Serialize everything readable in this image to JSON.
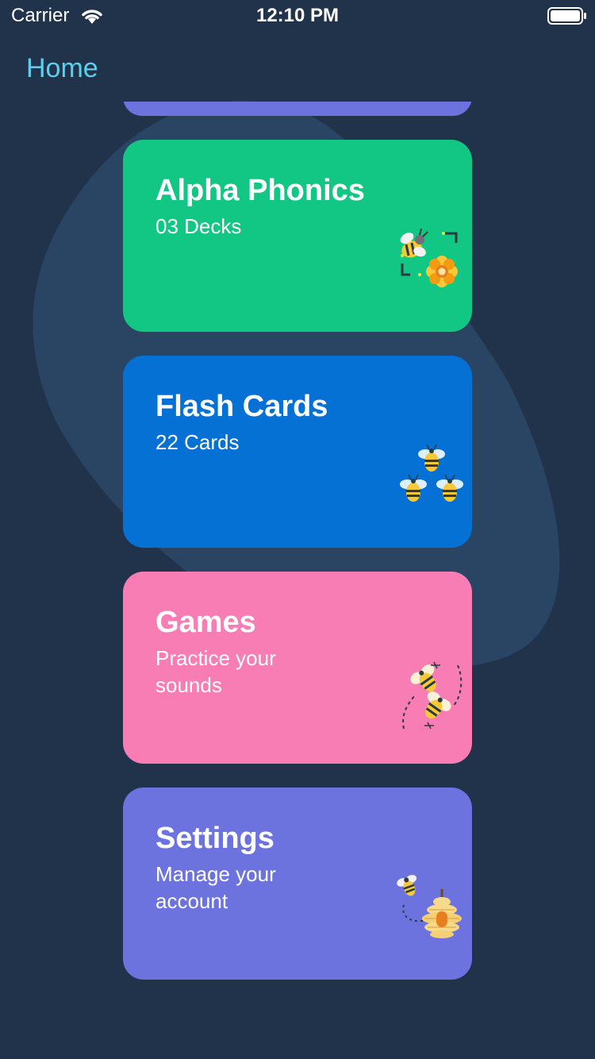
{
  "status_bar": {
    "carrier": "Carrier",
    "time": "12:10 PM",
    "wifi_icon": "wifi-icon",
    "battery_icon": "battery-icon"
  },
  "nav": {
    "title": "Home"
  },
  "colors": {
    "background": "#21334B",
    "blob": "#2A4564",
    "nav_title": "#5AD0EE",
    "peek_card": "#6C73DF"
  },
  "cards": [
    {
      "title": "Alpha Phonics",
      "subtitle": "03 Decks",
      "color": "#12C684",
      "icon": "bee-flower-icon"
    },
    {
      "title": "Flash Cards",
      "subtitle": "22 Cards",
      "color": "#0571D4",
      "icon": "bee-trio-icon"
    },
    {
      "title": "Games",
      "subtitle": "Practice your sounds",
      "color": "#F77DB4",
      "icon": "bees-flying-icon"
    },
    {
      "title": "Settings",
      "subtitle": "Manage your account",
      "color": "#6C73DF",
      "icon": "bee-hive-icon"
    }
  ]
}
